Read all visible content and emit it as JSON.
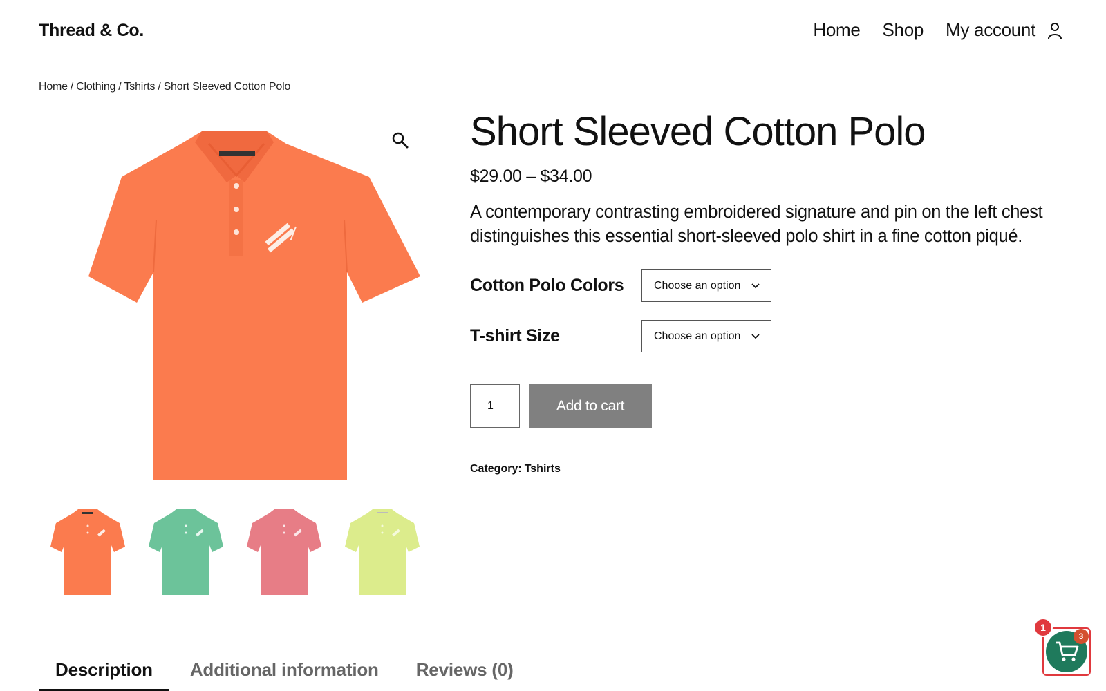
{
  "header": {
    "logo": "Thread & Co.",
    "nav": [
      {
        "label": "Home"
      },
      {
        "label": "Shop"
      },
      {
        "label": "My account"
      }
    ]
  },
  "breadcrumb": {
    "items": [
      "Home",
      "Clothing",
      "Tshirts"
    ],
    "current": "Short Sleeved Cotton Polo",
    "separator": "/"
  },
  "product": {
    "title": "Short Sleeved Cotton Polo",
    "price": "$29.00 – $34.00",
    "short_description": "A contemporary contrasting embroidered signature and pin on the left chest distinguishes this essential short-sleeved polo shirt in a fine cotton piqué.",
    "main_image_color": "#fb7b4e",
    "thumbnails": [
      {
        "name": "orange",
        "color": "#fb7b4e"
      },
      {
        "name": "green",
        "color": "#6cc39a"
      },
      {
        "name": "pink",
        "color": "#e77d86"
      },
      {
        "name": "lime",
        "color": "#dcec8c"
      }
    ]
  },
  "variations": {
    "colors": {
      "label": "Cotton Polo Colors",
      "selected": "Choose an option"
    },
    "size": {
      "label": "T-shirt Size",
      "selected": "Choose an option"
    }
  },
  "cart_form": {
    "quantity": "1",
    "add_to_cart_label": "Add to cart"
  },
  "meta": {
    "category_label": "Category:",
    "category_value": "Tshirts"
  },
  "tabs": [
    {
      "label": "Description",
      "active": true
    },
    {
      "label": "Additional information",
      "active": false
    },
    {
      "label": "Reviews (0)",
      "active": false
    }
  ],
  "mini_cart": {
    "count": "3",
    "notice": "1"
  },
  "colors": {
    "add_to_cart_bg": "#808080",
    "mini_cart_bg": "#1f7a5c",
    "badge_red": "#e0393e"
  }
}
